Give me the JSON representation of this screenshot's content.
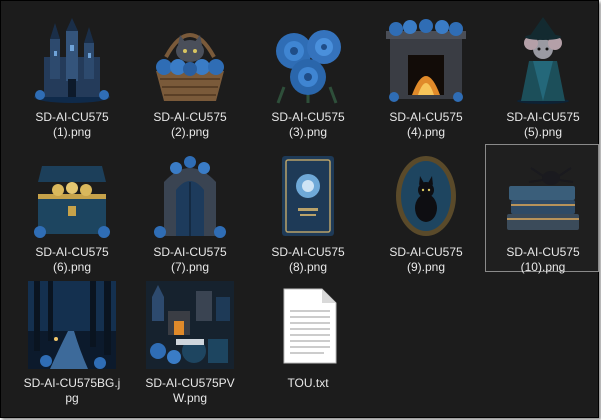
{
  "files": [
    {
      "name": "SD-AI-CU575\n(1).png",
      "icon": "castle-icon"
    },
    {
      "name": "SD-AI-CU575\n(2).png",
      "icon": "cat-basket-icon"
    },
    {
      "name": "SD-AI-CU575\n(3).png",
      "icon": "blue-roses-icon"
    },
    {
      "name": "SD-AI-CU575\n(4).png",
      "icon": "fireplace-icon"
    },
    {
      "name": "SD-AI-CU575\n(5).png",
      "icon": "witch-mouse-icon"
    },
    {
      "name": "SD-AI-CU575\n(6).png",
      "icon": "treasure-chest-icon"
    },
    {
      "name": "SD-AI-CU575\n(7).png",
      "icon": "gothic-door-icon"
    },
    {
      "name": "SD-AI-CU575\n(8).png",
      "icon": "spell-book-icon"
    },
    {
      "name": "SD-AI-CU575\n(9).png",
      "icon": "cat-frame-icon"
    },
    {
      "name": "SD-AI-CU575\n(10).png",
      "icon": "books-spider-icon",
      "selected": true
    },
    {
      "name": "SD-AI-CU575BG.j\npg",
      "icon": "forest-path-icon"
    },
    {
      "name": "SD-AI-CU575PV\nW.png",
      "icon": "preview-collage-icon"
    },
    {
      "name": "TOU.txt",
      "icon": "text-document-icon"
    }
  ],
  "colors": {
    "background": "#1c1c1c",
    "label": "#e8e8e8",
    "selection_border": "#8a8a8a",
    "accent_blue": "#2f6db5"
  }
}
